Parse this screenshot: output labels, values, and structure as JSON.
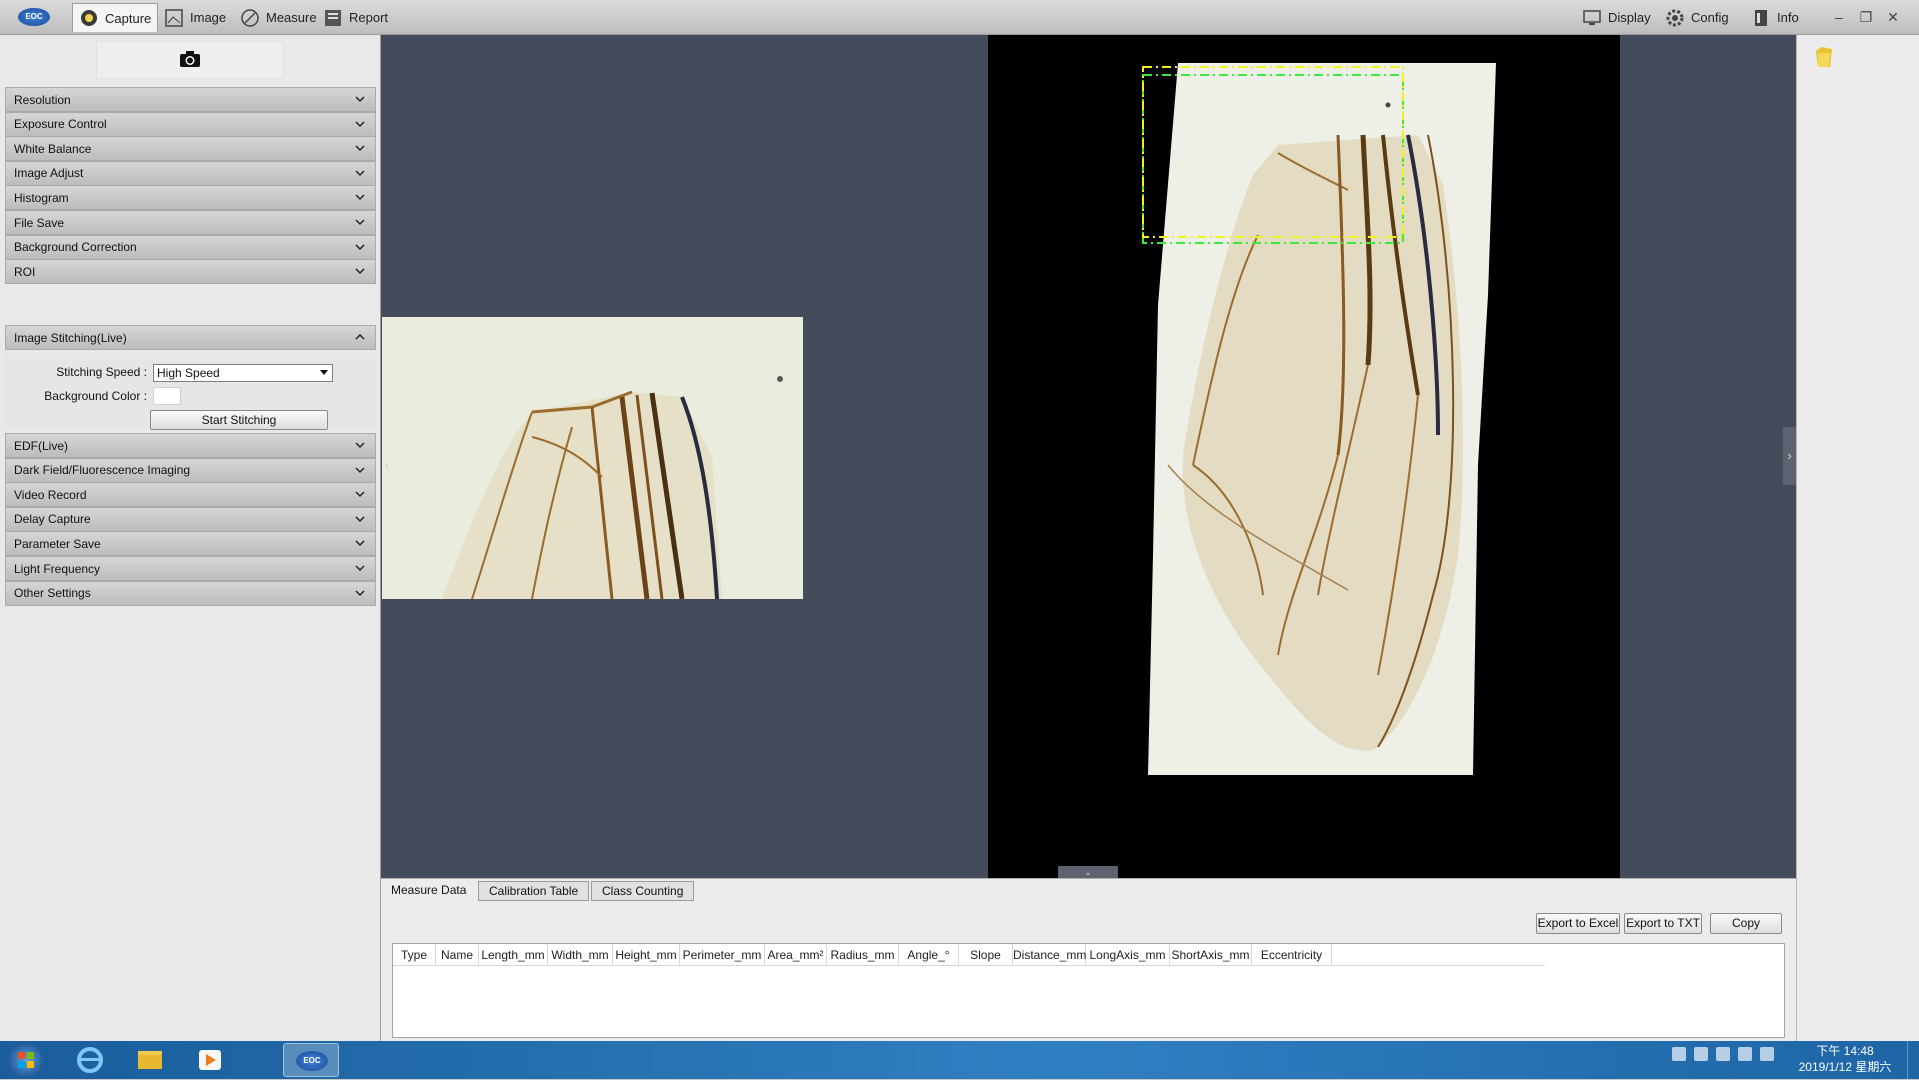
{
  "toolbar": {
    "tabs": [
      {
        "label": "Capture",
        "icon": "capture-icon",
        "active": true
      },
      {
        "label": "Image",
        "icon": "image-icon"
      },
      {
        "label": "Measure",
        "icon": "measure-icon"
      },
      {
        "label": "Report",
        "icon": "report-icon"
      }
    ],
    "right": [
      {
        "label": "Display",
        "icon": "monitor-icon"
      },
      {
        "label": "Config",
        "icon": "gear-icon"
      },
      {
        "label": "Info",
        "icon": "info-icon"
      }
    ],
    "logo": "EOC"
  },
  "left_panel": {
    "sections_top": [
      "Resolution",
      "Exposure Control",
      "White Balance",
      "Image Adjust",
      "Histogram",
      "File Save",
      "Background Correction",
      "ROI"
    ],
    "stitching": {
      "title": "Image Stitching(Live)",
      "speed_label": "Stitching Speed :",
      "speed_value": "High Speed",
      "bg_label": "Background Color :",
      "bg_color": "#ffffff",
      "start_button": "Start Stitching"
    },
    "sections_bottom": [
      "EDF(Live)",
      "Dark Field/Fluorescence Imaging",
      "Video Record",
      "Delay Capture",
      "Parameter Save",
      "Light Frequency",
      "Other Settings"
    ]
  },
  "bottom_panel": {
    "tabs": [
      "Measure Data",
      "Calibration Table",
      "Class Counting"
    ],
    "buttons": [
      "Export to Excel",
      "Export to TXT",
      "Copy"
    ],
    "columns": [
      "Type",
      "Name",
      "Length_mm",
      "Width_mm",
      "Height_mm",
      "Perimeter_mm",
      "Area_mm²",
      "Radius_mm",
      "Angle_°",
      "Slope",
      "Distance_mm",
      "LongAxis_mm",
      "ShortAxis_mm",
      "Eccentricity"
    ]
  },
  "taskbar": {
    "time": "下午 14:48",
    "date": "2019/1/12 星期六",
    "active_app": "EOC"
  },
  "colors": {
    "viewer_bg": "#444b5a",
    "roi_green": "#3ee83e",
    "roi_yellow": "#f2f21a"
  }
}
